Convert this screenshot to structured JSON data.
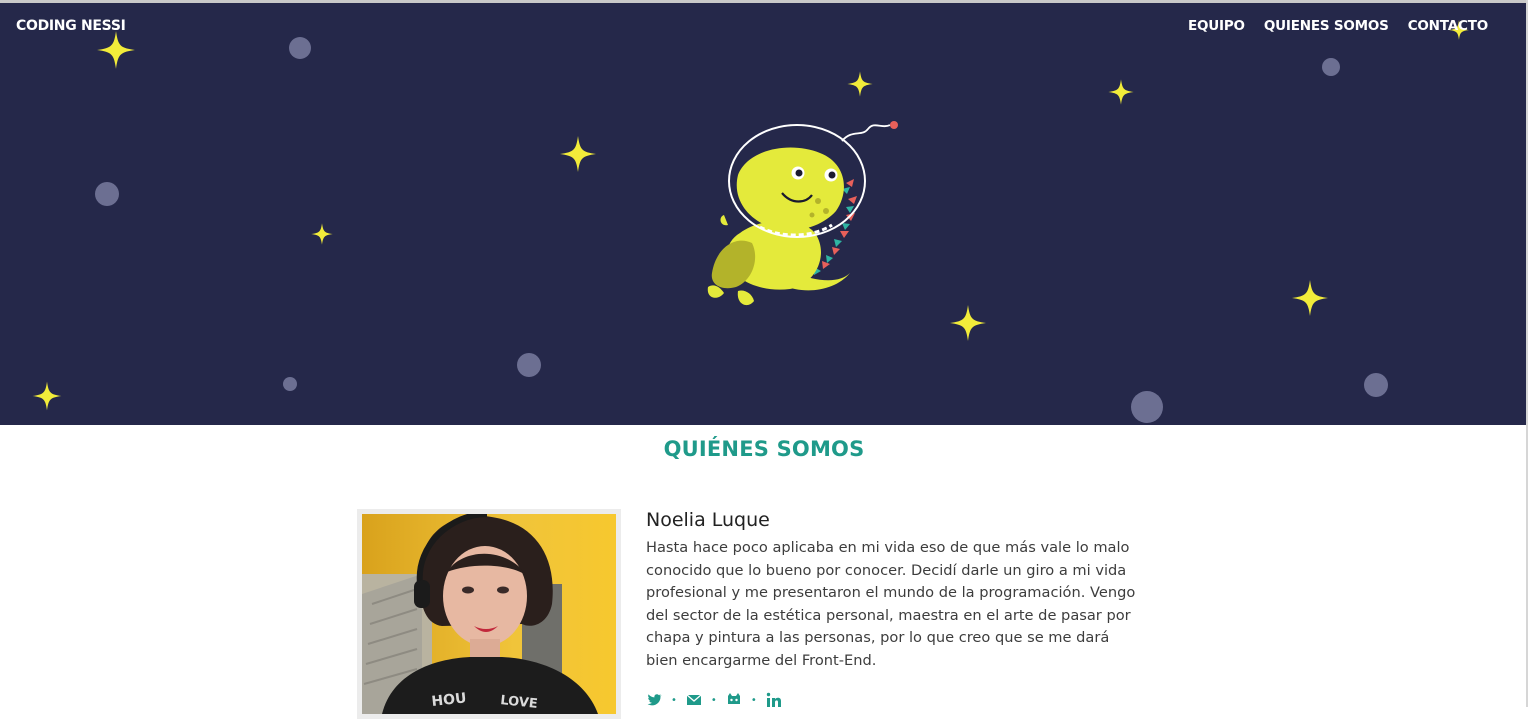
{
  "header": {
    "brand": "CODING NESSI",
    "nav": [
      "EQUIPO",
      "QUIENES SOMOS",
      "CONTACTO"
    ]
  },
  "colors": {
    "hero_bg": "#25284a",
    "star": "#f2ec3a",
    "planet": "#6c6f92",
    "accent": "#1f9a8a",
    "dino": "#e4ea3b"
  },
  "about": {
    "title": "QUIÉNES SOMOS",
    "member": {
      "name": "Noelia Luque",
      "bio": "Hasta hace poco aplicaba en mi vida eso de que más vale lo malo conocido que lo bueno por conocer. Decidí darle un giro a mi vida profesional y me presentaron el mundo de la programación. Vengo del sector de la estética personal, maestra en el arte de pasar por chapa y pintura a las personas, por lo que creo que se me dará bien encargarme del Front-End.",
      "social_icons": [
        "twitter-icon",
        "mail-icon",
        "github-icon",
        "linkedin-icon"
      ]
    }
  }
}
